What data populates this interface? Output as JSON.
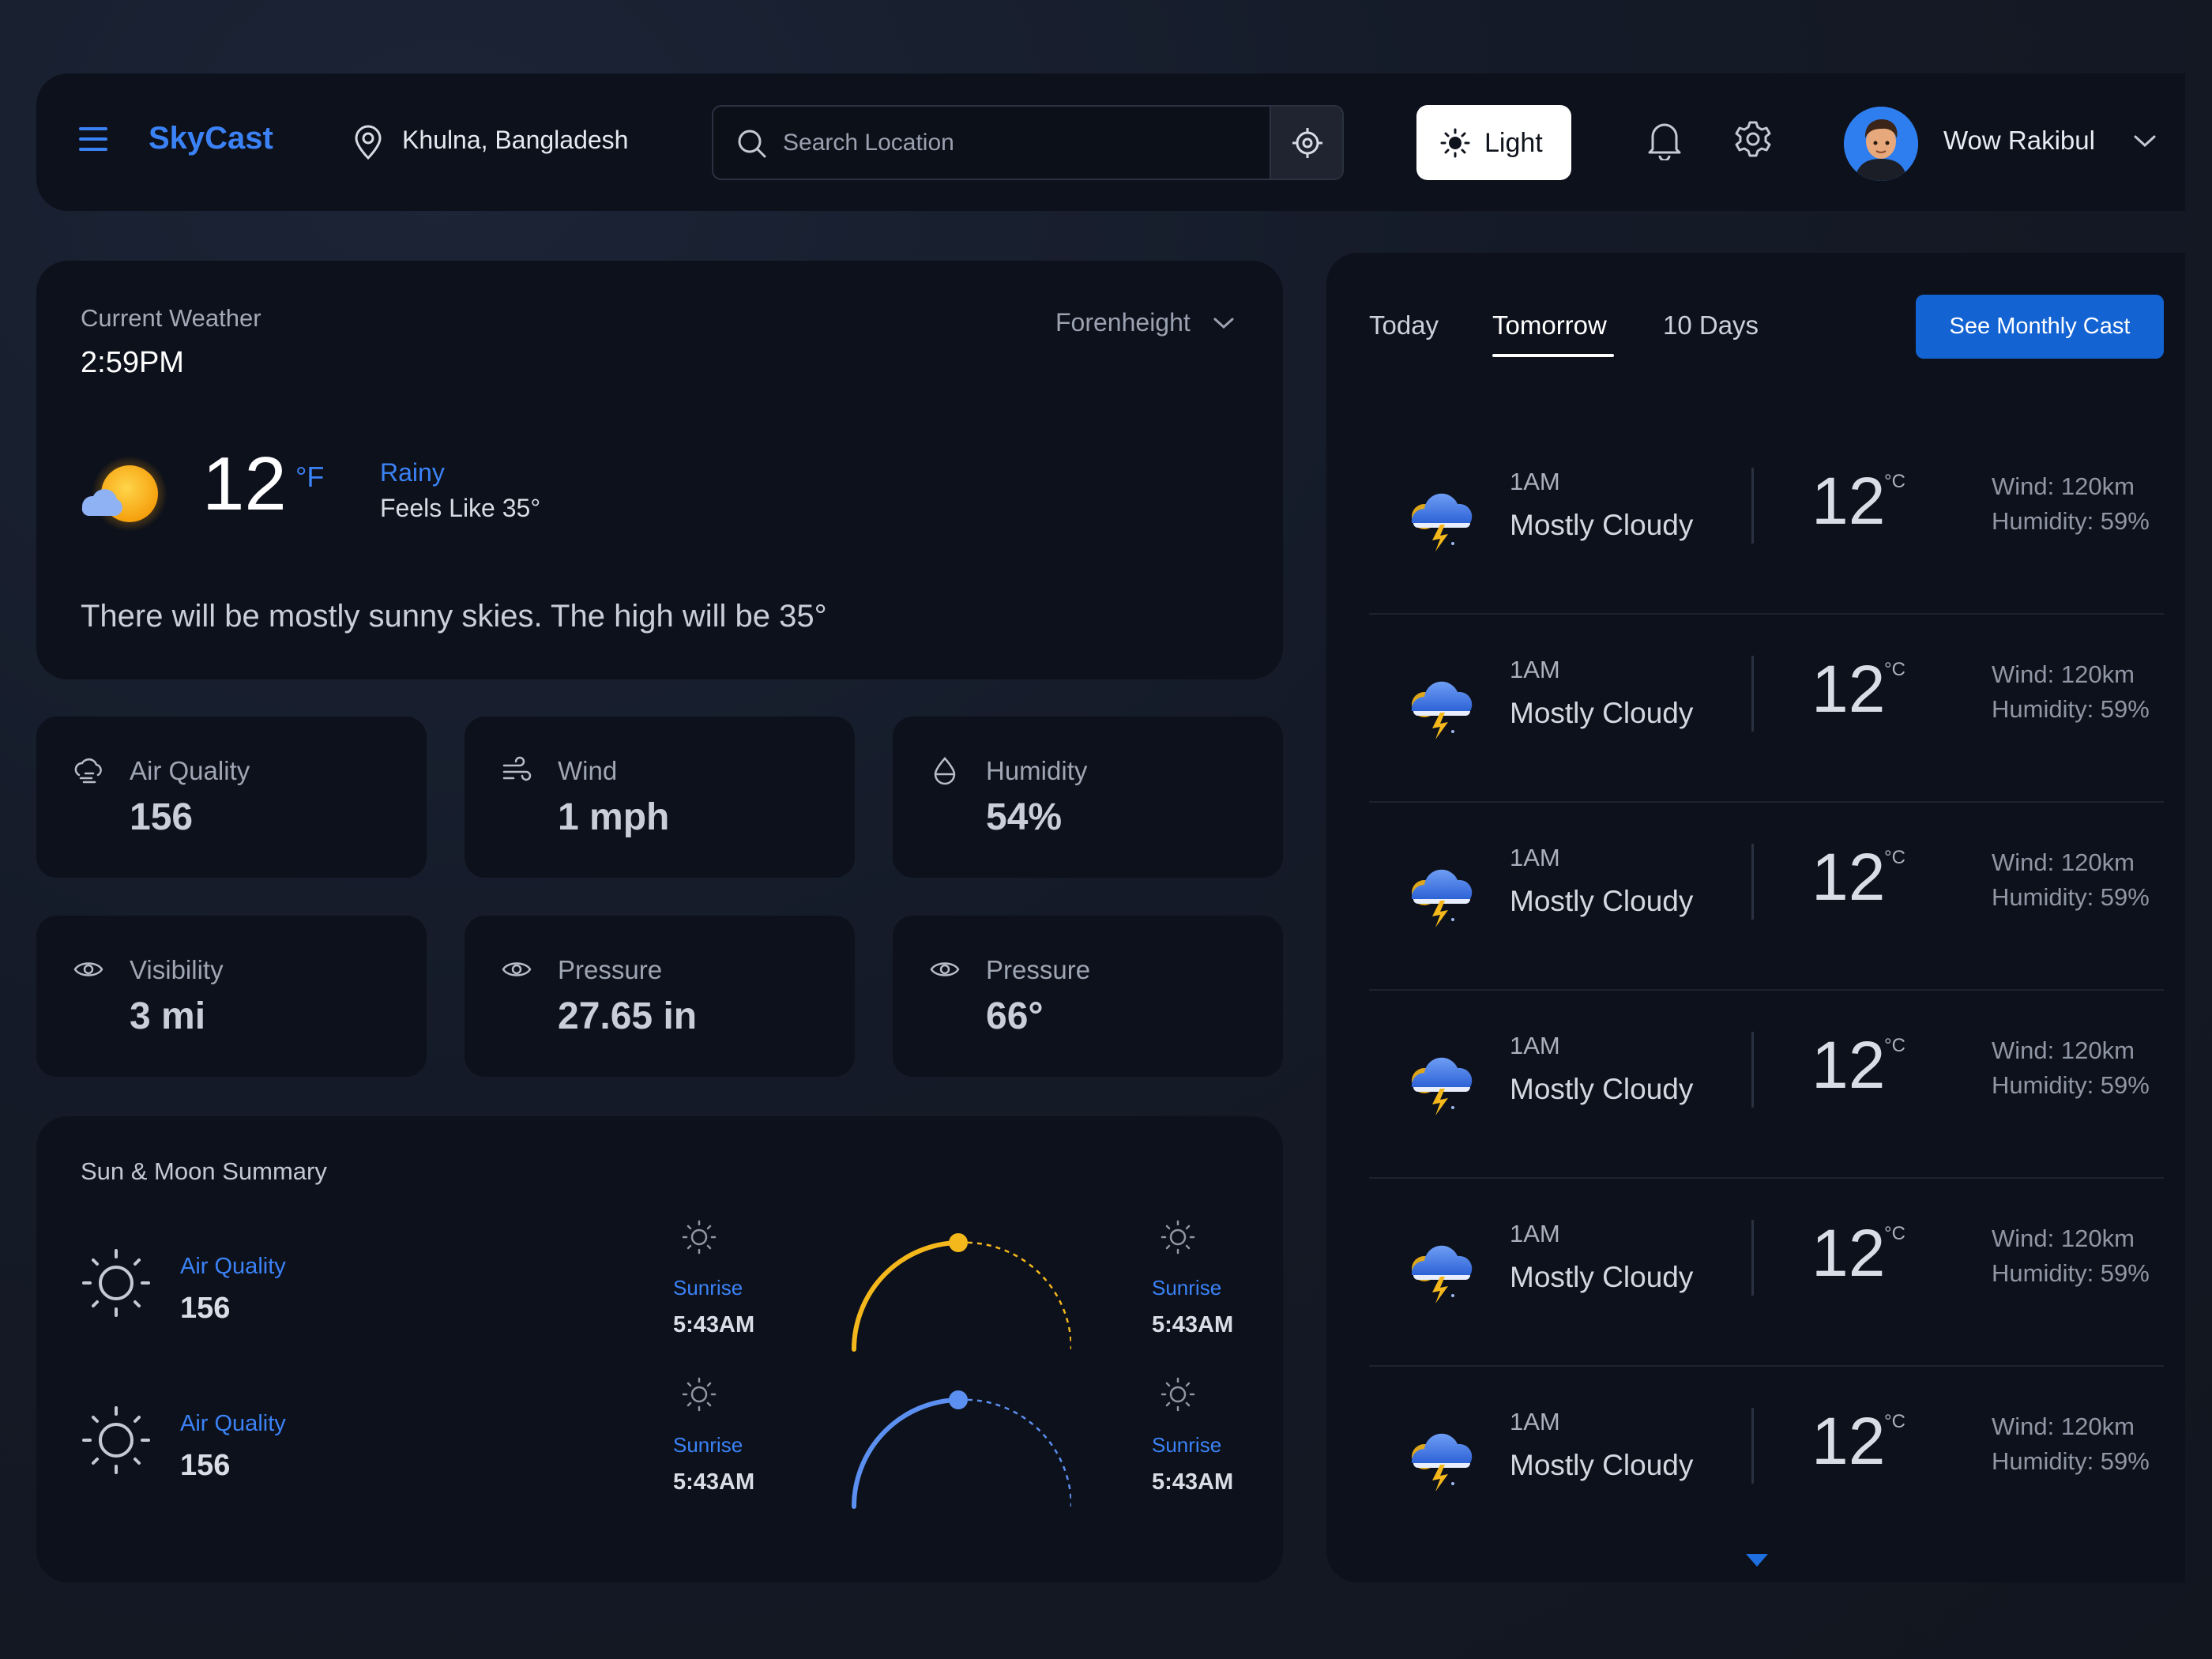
{
  "app": {
    "brand": "SkyCast",
    "location": "Khulna, Bangladesh",
    "search_placeholder": "Search Location",
    "theme_label": "Light",
    "user_name": "Wow Rakibul"
  },
  "current": {
    "title": "Current Weather",
    "time": "2:59PM",
    "unit_selector": "Forenheight",
    "temp": "12",
    "unit": "°F",
    "condition": "Rainy",
    "feels_like": "Feels Like 35°",
    "description": "There will be mostly sunny skies. The high will be 35°"
  },
  "stats": [
    {
      "label": "Air Quality",
      "value": "156",
      "icon": "air-quality-icon"
    },
    {
      "label": "Wind",
      "value": "1 mph",
      "icon": "wind-icon"
    },
    {
      "label": "Humidity",
      "value": "54%",
      "icon": "humidity-icon"
    },
    {
      "label": "Visibility",
      "value": "3 mi",
      "icon": "eye-icon"
    },
    {
      "label": "Pressure",
      "value": "27.65 in",
      "icon": "eye-icon"
    },
    {
      "label": "Pressure",
      "value": "66°",
      "icon": "eye-icon"
    }
  ],
  "sun_moon": {
    "title": "Sun & Moon Summary",
    "rows": [
      {
        "label": "Air Quality",
        "value": "156",
        "left_label": "Sunrise",
        "left_time": "5:43AM",
        "right_label": "Sunrise",
        "right_time": "5:43AM",
        "arc_color": "#f5b81c",
        "progress": 0.5
      },
      {
        "label": "Air Quality",
        "value": "156",
        "left_label": "Sunrise",
        "left_time": "5:43AM",
        "right_label": "Sunrise",
        "right_time": "5:43AM",
        "arc_color": "#5b8ff0",
        "progress": 0.5
      }
    ]
  },
  "forecast": {
    "tabs": [
      "Today",
      "Tomorrow",
      "10 Days"
    ],
    "active_tab": "Tomorrow",
    "monthly_button": "See Monthly Cast",
    "rows": [
      {
        "time": "1AM",
        "condition": "Mostly Cloudy",
        "temp": "12",
        "unit": "°C",
        "wind": "Wind: 120km",
        "humidity": "Humidity: 59%"
      },
      {
        "time": "1AM",
        "condition": "Mostly Cloudy",
        "temp": "12",
        "unit": "°C",
        "wind": "Wind: 120km",
        "humidity": "Humidity: 59%"
      },
      {
        "time": "1AM",
        "condition": "Mostly Cloudy",
        "temp": "12",
        "unit": "°C",
        "wind": "Wind: 120km",
        "humidity": "Humidity: 59%"
      },
      {
        "time": "1AM",
        "condition": "Mostly Cloudy",
        "temp": "12",
        "unit": "°C",
        "wind": "Wind: 120km",
        "humidity": "Humidity: 59%"
      },
      {
        "time": "1AM",
        "condition": "Mostly Cloudy",
        "temp": "12",
        "unit": "°C",
        "wind": "Wind: 120km",
        "humidity": "Humidity: 59%"
      },
      {
        "time": "1AM",
        "condition": "Mostly Cloudy",
        "temp": "12",
        "unit": "°C",
        "wind": "Wind: 120km",
        "humidity": "Humidity: 59%"
      }
    ]
  },
  "colors": {
    "accent": "#3b82f6",
    "panel": "#0d111b",
    "button": "#1463d3"
  }
}
